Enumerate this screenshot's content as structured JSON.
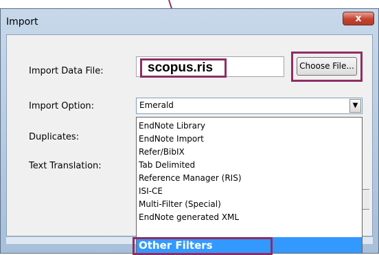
{
  "window": {
    "title": "Import",
    "close_label": "x"
  },
  "form": {
    "import_data_file_label": "Import Data File:",
    "file_value": "scopus.ris",
    "choose_file_label": "Choose File...",
    "import_option_label": "Import Option:",
    "import_option_value": "Emerald",
    "duplicates_label": "Duplicates:",
    "text_translation_label": "Text Translation:"
  },
  "import_options": [
    "EndNote Library",
    "EndNote Import",
    "Refer/BibIX",
    "Tab Delimited",
    "Reference Manager (RIS)",
    "ISI-CE",
    "Multi-Filter (Special)",
    "EndNote generated XML",
    "Other Filters"
  ],
  "selected_option": "Other Filters",
  "icons": {
    "dropdown": "chevron-down-icon",
    "close": "close-icon",
    "annotation": "arrow-pointer-icon"
  },
  "colors": {
    "highlight": "#8e2d63",
    "selection": "#3399ff"
  }
}
